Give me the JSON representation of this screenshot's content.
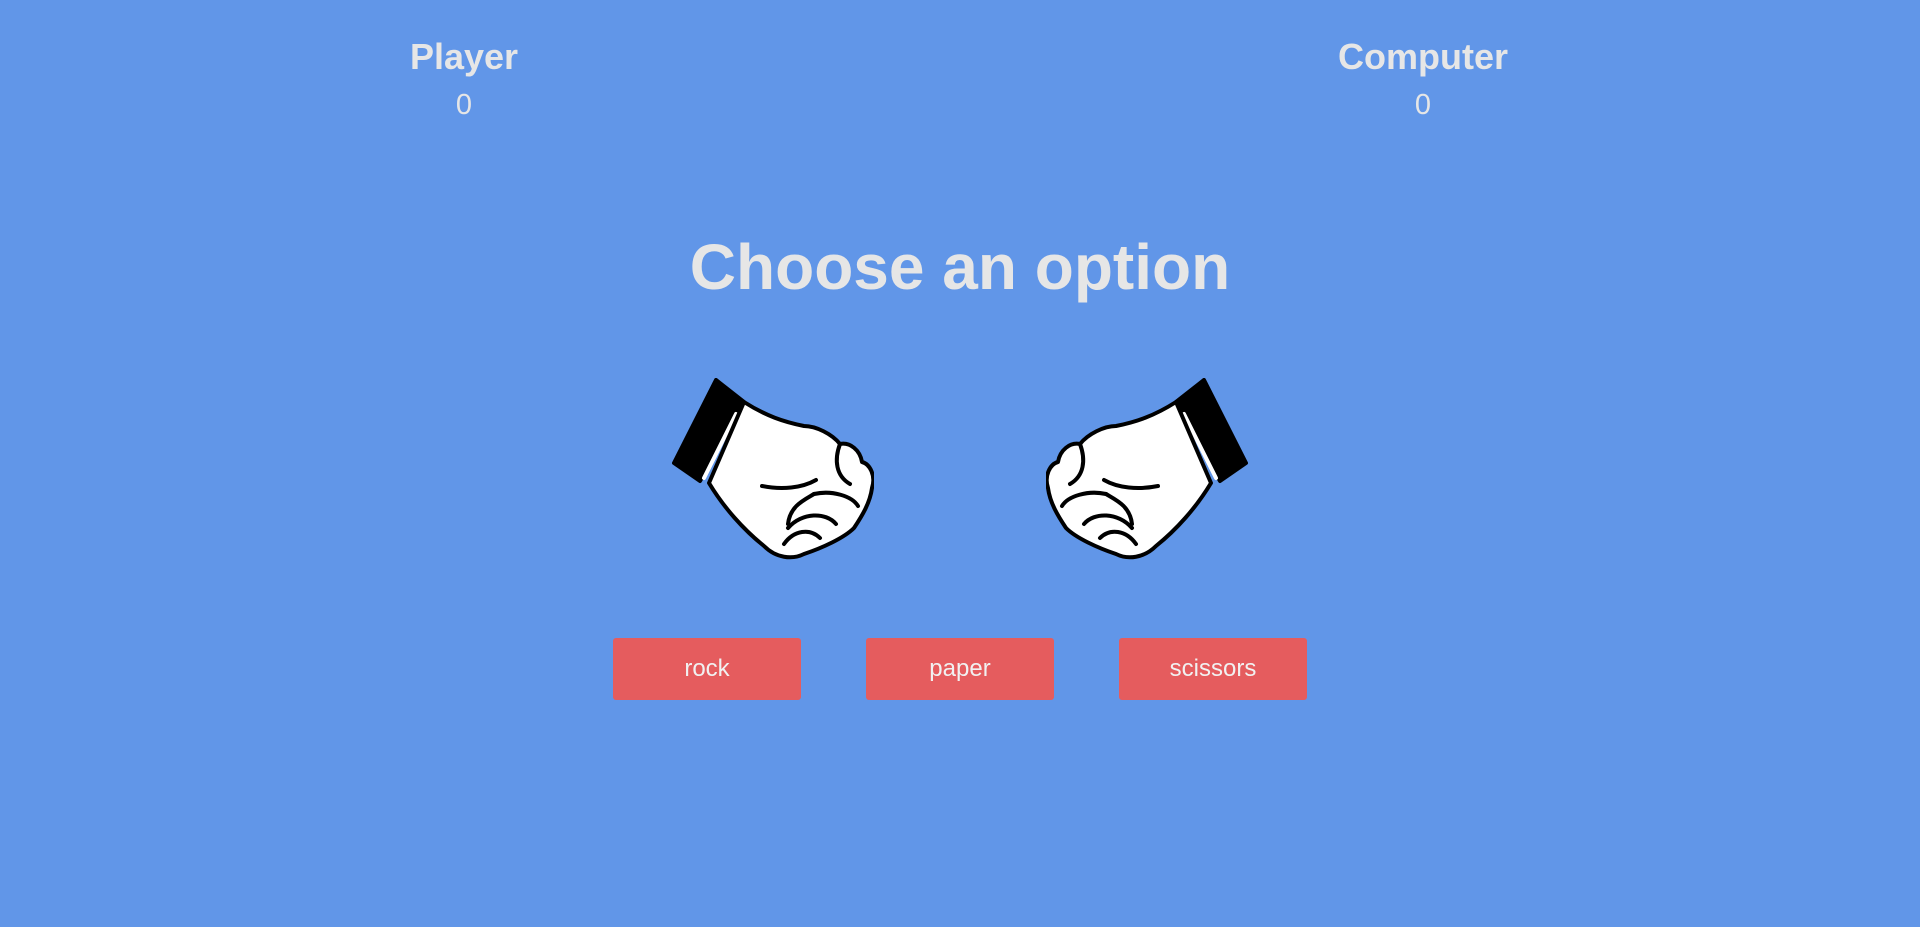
{
  "scoreboard": {
    "player": {
      "label": "Player",
      "score": "0"
    },
    "computer": {
      "label": "Computer",
      "score": "0"
    }
  },
  "message": "Choose an option",
  "hands": {
    "player": {
      "icon": "rock-fist-icon"
    },
    "computer": {
      "icon": "rock-fist-icon"
    }
  },
  "options": [
    {
      "label": "rock"
    },
    {
      "label": "paper"
    },
    {
      "label": "scissors"
    }
  ],
  "colors": {
    "background": "#6196e8",
    "text": "#e6e6e6",
    "button": "#e55c5e",
    "button_text": "#f1f1f1"
  }
}
